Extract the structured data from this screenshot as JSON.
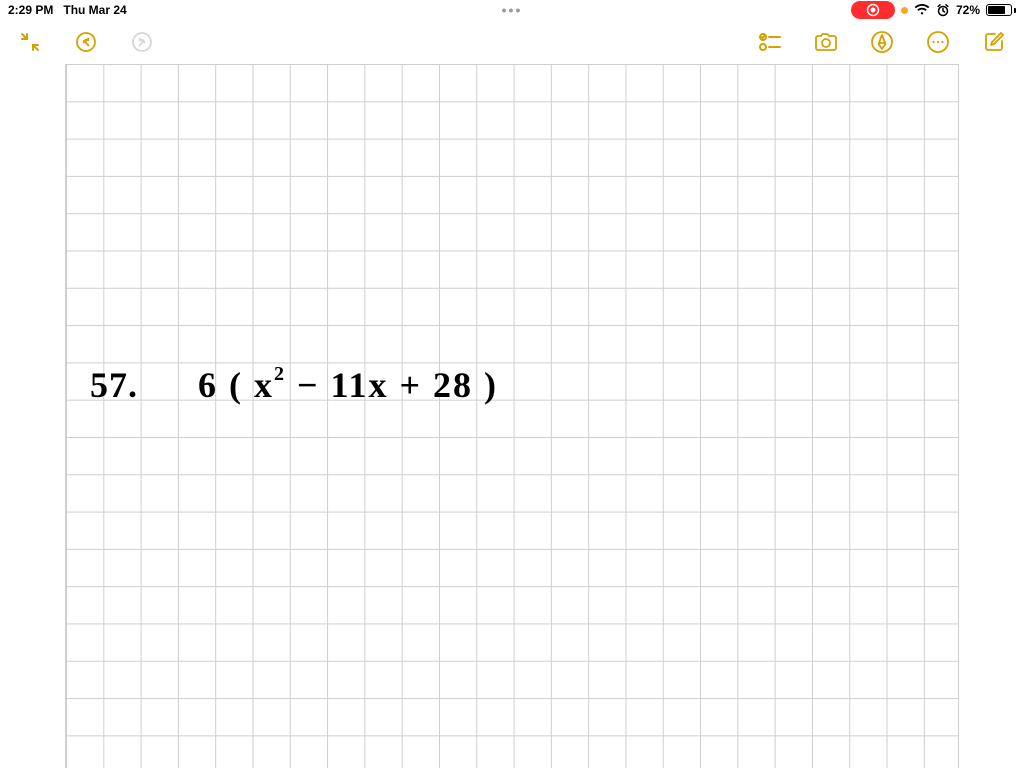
{
  "status": {
    "time": "2:29 PM",
    "date": "Thu Mar 24",
    "ellipsis": "•••",
    "battery_percent": "72%"
  },
  "toolbar": {
    "collapse": "collapse",
    "undo": "undo",
    "redo": "redo",
    "checklist": "checklist",
    "camera": "camera",
    "markup": "markup",
    "more": "more",
    "compose": "compose"
  },
  "note": {
    "problem_no": "57.",
    "expr_prefix": "6 ( x",
    "expr_super": "2",
    "expr_suffix": " − 11x  +  28 )",
    "full_text": "57.   6 ( x² − 11x + 28 )"
  },
  "colors": {
    "accent": "#d5a100",
    "record": "#ff2d2d",
    "orange_dot": "#f5a623",
    "grid_line": "#cfcfcf"
  }
}
